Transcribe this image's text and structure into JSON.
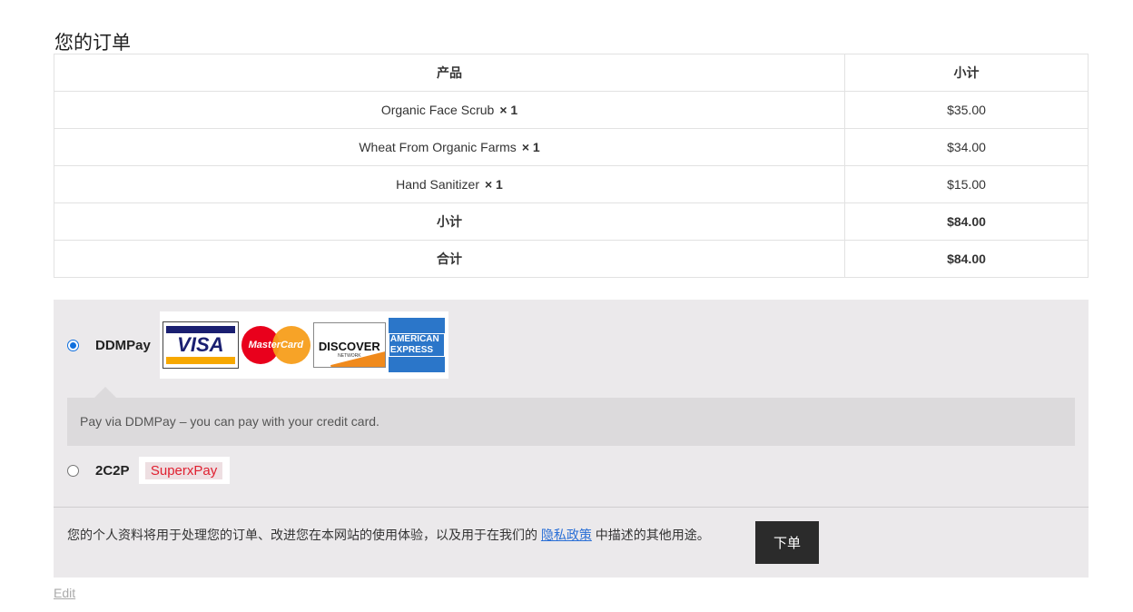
{
  "page": {
    "title": "您的订单"
  },
  "order_table": {
    "headers": {
      "product": "产品",
      "subtotal": "小计"
    },
    "items": [
      {
        "name": "Organic Face Scrub",
        "qty": "× 1",
        "price": "$35.00"
      },
      {
        "name": "Wheat From Organic Farms",
        "qty": "× 1",
        "price": "$34.00"
      },
      {
        "name": "Hand Sanitizer",
        "qty": "× 1",
        "price": "$15.00"
      }
    ],
    "subtotal": {
      "label": "小计",
      "value": "$84.00"
    },
    "total": {
      "label": "合计",
      "value": "$84.00"
    }
  },
  "payment": {
    "methods": [
      {
        "label": "DDMPay",
        "selected": true,
        "card_logos": [
          "VISA",
          "MasterCard",
          "DISCOVER",
          "AMERICAN EXPRESS"
        ],
        "description": "Pay via DDMPay – you can pay with your credit card."
      },
      {
        "label": "2C2P",
        "selected": false,
        "logo_text": "SuperxPay"
      }
    ],
    "card_logo_sub": {
      "discover_network": "NETWORK"
    }
  },
  "privacy": {
    "text_before": "您的个人资料将用于处理您的订单、改进您在本网站的使用体验，以及用于在我们的 ",
    "link_text": "隐私政策",
    "text_after": " 中描述的其他用途。"
  },
  "place_order_label": "下单",
  "edit_link": "Edit",
  "colors": {
    "panel_bg": "#ebe9eb",
    "button_bg": "#2b2b2b",
    "link": "#2a6fd6"
  }
}
